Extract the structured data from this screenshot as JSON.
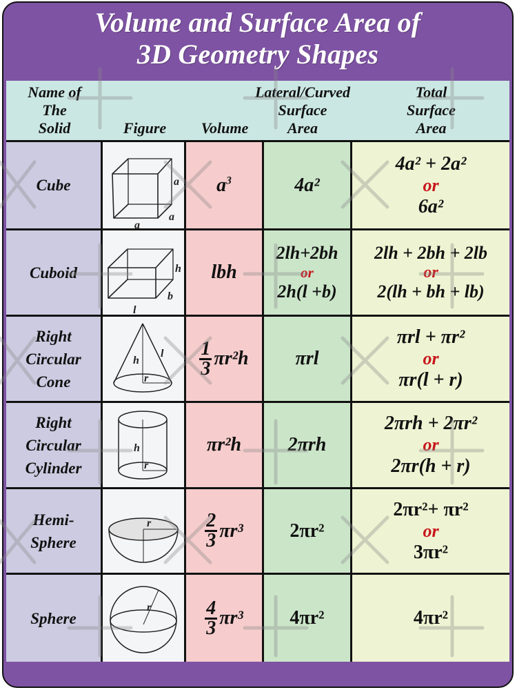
{
  "title": {
    "line1": "Volume and Surface Area of",
    "line2": "3D Geometry Shapes"
  },
  "header": {
    "name": [
      "Name of",
      "The",
      "Solid"
    ],
    "figure": "Figure",
    "volume": "Volume",
    "lateral": [
      "Lateral/Curved",
      "Surface",
      "Area"
    ],
    "total": [
      "Total",
      "Surface",
      "Area"
    ]
  },
  "or_label": "or",
  "colors": {
    "frame": "#7e53a3",
    "header_bg": "#cbe7e3",
    "name_bg": "#cccbe1",
    "figure_bg": "#f4f5f7",
    "volume_bg": "#f6cccc",
    "lateral_bg": "#cbe5c9",
    "total_bg": "#eef4d3",
    "or_color": "#c8171c"
  },
  "rows": [
    {
      "name": [
        "Cube"
      ],
      "figure": "cube-figure",
      "figure_labels": [
        "a",
        "a",
        "a"
      ],
      "volume": {
        "base": "a",
        "exp": "3"
      },
      "lateral": [
        "4a²"
      ],
      "total": [
        "4a² + 2a²",
        "6a²"
      ]
    },
    {
      "name": [
        "Cuboid"
      ],
      "figure": "cuboid-figure",
      "figure_labels": [
        "h",
        "b",
        "l"
      ],
      "volume": {
        "text": "lbh"
      },
      "lateral": [
        "2lh+2bh",
        "2h(l +b)"
      ],
      "total": [
        "2lh + 2bh + 2lb",
        "2(lh + bh + lb)"
      ]
    },
    {
      "name": [
        "Right",
        "Circular",
        "Cone"
      ],
      "figure": "cone-figure",
      "figure_labels": [
        "h",
        "l",
        "r"
      ],
      "volume": {
        "frac_num": "1",
        "frac_den": "3",
        "rest": "πr²h"
      },
      "lateral": [
        "πrl"
      ],
      "total": [
        "πrl + πr²",
        "πr(l + r)"
      ]
    },
    {
      "name": [
        "Right",
        "Circular",
        "Cylinder"
      ],
      "figure": "cylinder-figure",
      "figure_labels": [
        "h",
        "r"
      ],
      "volume": {
        "text": "πr²h"
      },
      "lateral": [
        "2πrh"
      ],
      "total": [
        "2πrh + 2πr²",
        "2πr(h + r)"
      ]
    },
    {
      "name": [
        "Hemi-",
        "Sphere"
      ],
      "figure": "hemisphere-figure",
      "figure_labels": [
        "r"
      ],
      "volume": {
        "frac_num": "2",
        "frac_den": "3",
        "rest": "πr³"
      },
      "lateral": [
        "2πr²"
      ],
      "total": [
        "2πr²+ πr²",
        "3πr²"
      ]
    },
    {
      "name": [
        "Sphere"
      ],
      "figure": "sphere-figure",
      "figure_labels": [
        "r"
      ],
      "volume": {
        "frac_num": "4",
        "frac_den": "3",
        "rest": "πr³"
      },
      "lateral": [
        "4πr²"
      ],
      "total": [
        "4πr²"
      ]
    }
  ]
}
